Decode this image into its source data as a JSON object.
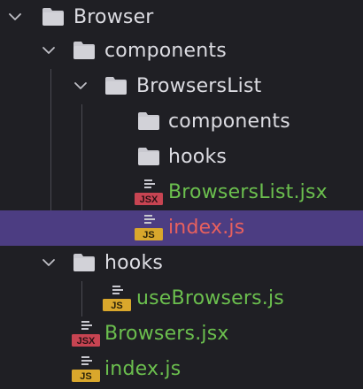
{
  "colors": {
    "background": "#1f1f24",
    "selection": "#4c3d82",
    "folder_text": "#dcdce2",
    "new_file_text": "#6bbf4e",
    "modified_file_text": "#e8605e",
    "folder_icon": "#c8c8cf",
    "js_badge": "#d9a72c",
    "jsx_badge": "#c74452"
  },
  "tree": {
    "browser": {
      "label": "Browser",
      "icon": "folder-icon",
      "expanded": true
    },
    "components": {
      "label": "components",
      "icon": "folder-icon",
      "expanded": true
    },
    "browsers_list": {
      "label": "BrowsersList",
      "icon": "folder-icon",
      "expanded": true
    },
    "bl_components": {
      "label": "components",
      "icon": "folder-icon",
      "expanded": false
    },
    "bl_hooks": {
      "label": "hooks",
      "icon": "folder-icon",
      "expanded": false
    },
    "browsers_list_jsx": {
      "label": "BrowsersList.jsx",
      "icon": "jsx-file-icon",
      "badge": "JSX",
      "status": "new"
    },
    "bl_index_js": {
      "label": "index.js",
      "icon": "js-file-icon",
      "badge": "JS",
      "status": "modified",
      "selected": true
    },
    "hooks": {
      "label": "hooks",
      "icon": "folder-icon",
      "expanded": true
    },
    "use_browsers_js": {
      "label": "useBrowsers.js",
      "icon": "js-file-icon",
      "badge": "JS",
      "status": "new"
    },
    "browsers_jsx": {
      "label": "Browsers.jsx",
      "icon": "jsx-file-icon",
      "badge": "JSX",
      "status": "new"
    },
    "index_js": {
      "label": "index.js",
      "icon": "js-file-icon",
      "badge": "JS",
      "status": "new"
    }
  }
}
